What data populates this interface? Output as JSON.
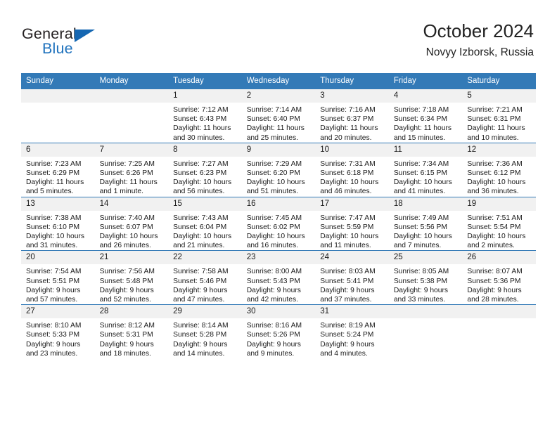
{
  "brand": {
    "name_primary": "General",
    "name_secondary": "Blue",
    "accent_color": "#1567b2"
  },
  "header": {
    "title": "October 2024",
    "subtitle": "Novyy Izborsk, Russia"
  },
  "theme": {
    "header_row_color": "#337ab7",
    "date_band_color": "#f1f1f1",
    "grid_line_color": "#337ab7"
  },
  "weekday_headers": [
    "Sunday",
    "Monday",
    "Tuesday",
    "Wednesday",
    "Thursday",
    "Friday",
    "Saturday"
  ],
  "labels": {
    "sunrise_prefix": "Sunrise:",
    "sunset_prefix": "Sunset:",
    "daylight_prefix": "Daylight:"
  },
  "weeks": [
    [
      {
        "day": "",
        "sunrise": "",
        "sunset": "",
        "daylight_line1": "",
        "daylight_line2": ""
      },
      {
        "day": "",
        "sunrise": "",
        "sunset": "",
        "daylight_line1": "",
        "daylight_line2": ""
      },
      {
        "day": "1",
        "sunrise": "Sunrise: 7:12 AM",
        "sunset": "Sunset: 6:43 PM",
        "daylight_line1": "Daylight: 11 hours",
        "daylight_line2": "and 30 minutes."
      },
      {
        "day": "2",
        "sunrise": "Sunrise: 7:14 AM",
        "sunset": "Sunset: 6:40 PM",
        "daylight_line1": "Daylight: 11 hours",
        "daylight_line2": "and 25 minutes."
      },
      {
        "day": "3",
        "sunrise": "Sunrise: 7:16 AM",
        "sunset": "Sunset: 6:37 PM",
        "daylight_line1": "Daylight: 11 hours",
        "daylight_line2": "and 20 minutes."
      },
      {
        "day": "4",
        "sunrise": "Sunrise: 7:18 AM",
        "sunset": "Sunset: 6:34 PM",
        "daylight_line1": "Daylight: 11 hours",
        "daylight_line2": "and 15 minutes."
      },
      {
        "day": "5",
        "sunrise": "Sunrise: 7:21 AM",
        "sunset": "Sunset: 6:31 PM",
        "daylight_line1": "Daylight: 11 hours",
        "daylight_line2": "and 10 minutes."
      }
    ],
    [
      {
        "day": "6",
        "sunrise": "Sunrise: 7:23 AM",
        "sunset": "Sunset: 6:29 PM",
        "daylight_line1": "Daylight: 11 hours",
        "daylight_line2": "and 5 minutes."
      },
      {
        "day": "7",
        "sunrise": "Sunrise: 7:25 AM",
        "sunset": "Sunset: 6:26 PM",
        "daylight_line1": "Daylight: 11 hours",
        "daylight_line2": "and 1 minute."
      },
      {
        "day": "8",
        "sunrise": "Sunrise: 7:27 AM",
        "sunset": "Sunset: 6:23 PM",
        "daylight_line1": "Daylight: 10 hours",
        "daylight_line2": "and 56 minutes."
      },
      {
        "day": "9",
        "sunrise": "Sunrise: 7:29 AM",
        "sunset": "Sunset: 6:20 PM",
        "daylight_line1": "Daylight: 10 hours",
        "daylight_line2": "and 51 minutes."
      },
      {
        "day": "10",
        "sunrise": "Sunrise: 7:31 AM",
        "sunset": "Sunset: 6:18 PM",
        "daylight_line1": "Daylight: 10 hours",
        "daylight_line2": "and 46 minutes."
      },
      {
        "day": "11",
        "sunrise": "Sunrise: 7:34 AM",
        "sunset": "Sunset: 6:15 PM",
        "daylight_line1": "Daylight: 10 hours",
        "daylight_line2": "and 41 minutes."
      },
      {
        "day": "12",
        "sunrise": "Sunrise: 7:36 AM",
        "sunset": "Sunset: 6:12 PM",
        "daylight_line1": "Daylight: 10 hours",
        "daylight_line2": "and 36 minutes."
      }
    ],
    [
      {
        "day": "13",
        "sunrise": "Sunrise: 7:38 AM",
        "sunset": "Sunset: 6:10 PM",
        "daylight_line1": "Daylight: 10 hours",
        "daylight_line2": "and 31 minutes."
      },
      {
        "day": "14",
        "sunrise": "Sunrise: 7:40 AM",
        "sunset": "Sunset: 6:07 PM",
        "daylight_line1": "Daylight: 10 hours",
        "daylight_line2": "and 26 minutes."
      },
      {
        "day": "15",
        "sunrise": "Sunrise: 7:43 AM",
        "sunset": "Sunset: 6:04 PM",
        "daylight_line1": "Daylight: 10 hours",
        "daylight_line2": "and 21 minutes."
      },
      {
        "day": "16",
        "sunrise": "Sunrise: 7:45 AM",
        "sunset": "Sunset: 6:02 PM",
        "daylight_line1": "Daylight: 10 hours",
        "daylight_line2": "and 16 minutes."
      },
      {
        "day": "17",
        "sunrise": "Sunrise: 7:47 AM",
        "sunset": "Sunset: 5:59 PM",
        "daylight_line1": "Daylight: 10 hours",
        "daylight_line2": "and 11 minutes."
      },
      {
        "day": "18",
        "sunrise": "Sunrise: 7:49 AM",
        "sunset": "Sunset: 5:56 PM",
        "daylight_line1": "Daylight: 10 hours",
        "daylight_line2": "and 7 minutes."
      },
      {
        "day": "19",
        "sunrise": "Sunrise: 7:51 AM",
        "sunset": "Sunset: 5:54 PM",
        "daylight_line1": "Daylight: 10 hours",
        "daylight_line2": "and 2 minutes."
      }
    ],
    [
      {
        "day": "20",
        "sunrise": "Sunrise: 7:54 AM",
        "sunset": "Sunset: 5:51 PM",
        "daylight_line1": "Daylight: 9 hours",
        "daylight_line2": "and 57 minutes."
      },
      {
        "day": "21",
        "sunrise": "Sunrise: 7:56 AM",
        "sunset": "Sunset: 5:48 PM",
        "daylight_line1": "Daylight: 9 hours",
        "daylight_line2": "and 52 minutes."
      },
      {
        "day": "22",
        "sunrise": "Sunrise: 7:58 AM",
        "sunset": "Sunset: 5:46 PM",
        "daylight_line1": "Daylight: 9 hours",
        "daylight_line2": "and 47 minutes."
      },
      {
        "day": "23",
        "sunrise": "Sunrise: 8:00 AM",
        "sunset": "Sunset: 5:43 PM",
        "daylight_line1": "Daylight: 9 hours",
        "daylight_line2": "and 42 minutes."
      },
      {
        "day": "24",
        "sunrise": "Sunrise: 8:03 AM",
        "sunset": "Sunset: 5:41 PM",
        "daylight_line1": "Daylight: 9 hours",
        "daylight_line2": "and 37 minutes."
      },
      {
        "day": "25",
        "sunrise": "Sunrise: 8:05 AM",
        "sunset": "Sunset: 5:38 PM",
        "daylight_line1": "Daylight: 9 hours",
        "daylight_line2": "and 33 minutes."
      },
      {
        "day": "26",
        "sunrise": "Sunrise: 8:07 AM",
        "sunset": "Sunset: 5:36 PM",
        "daylight_line1": "Daylight: 9 hours",
        "daylight_line2": "and 28 minutes."
      }
    ],
    [
      {
        "day": "27",
        "sunrise": "Sunrise: 8:10 AM",
        "sunset": "Sunset: 5:33 PM",
        "daylight_line1": "Daylight: 9 hours",
        "daylight_line2": "and 23 minutes."
      },
      {
        "day": "28",
        "sunrise": "Sunrise: 8:12 AM",
        "sunset": "Sunset: 5:31 PM",
        "daylight_line1": "Daylight: 9 hours",
        "daylight_line2": "and 18 minutes."
      },
      {
        "day": "29",
        "sunrise": "Sunrise: 8:14 AM",
        "sunset": "Sunset: 5:28 PM",
        "daylight_line1": "Daylight: 9 hours",
        "daylight_line2": "and 14 minutes."
      },
      {
        "day": "30",
        "sunrise": "Sunrise: 8:16 AM",
        "sunset": "Sunset: 5:26 PM",
        "daylight_line1": "Daylight: 9 hours",
        "daylight_line2": "and 9 minutes."
      },
      {
        "day": "31",
        "sunrise": "Sunrise: 8:19 AM",
        "sunset": "Sunset: 5:24 PM",
        "daylight_line1": "Daylight: 9 hours",
        "daylight_line2": "and 4 minutes."
      },
      {
        "day": "",
        "sunrise": "",
        "sunset": "",
        "daylight_line1": "",
        "daylight_line2": ""
      },
      {
        "day": "",
        "sunrise": "",
        "sunset": "",
        "daylight_line1": "",
        "daylight_line2": ""
      }
    ]
  ]
}
